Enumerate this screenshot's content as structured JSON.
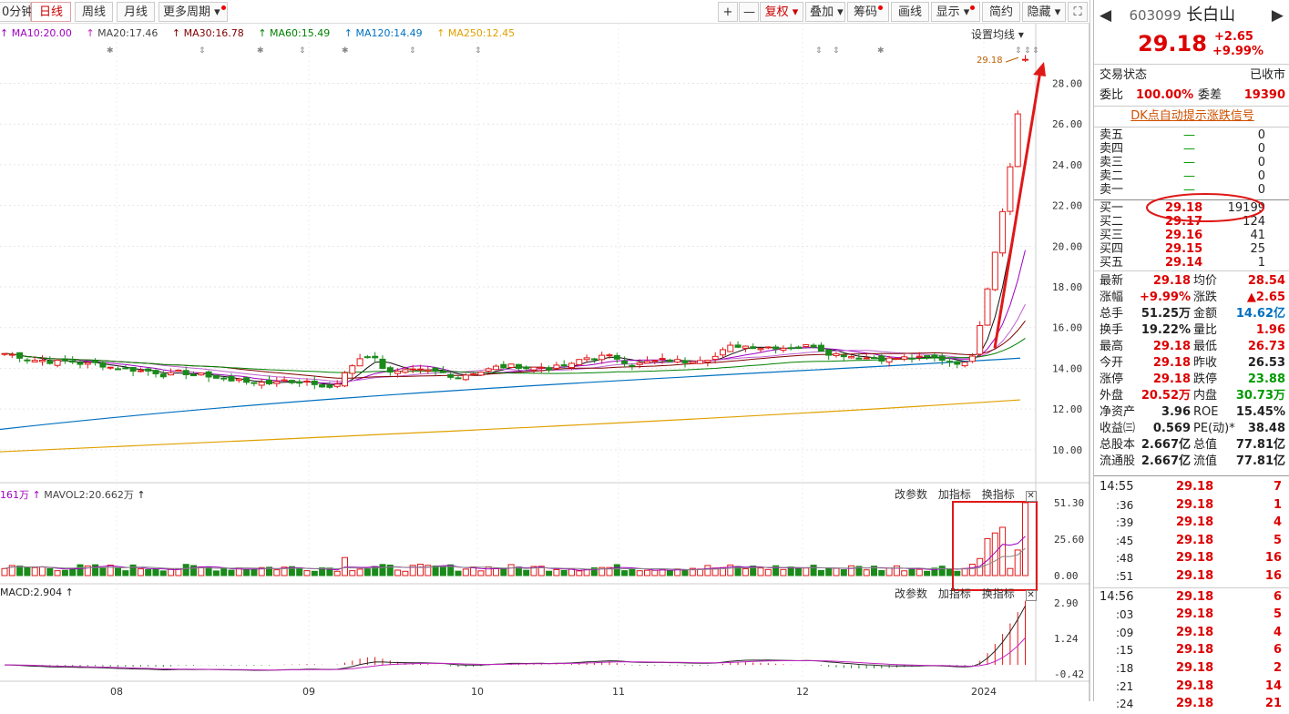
{
  "toolbar": {
    "tabs": [
      {
        "label": "0分钟",
        "active": false
      },
      {
        "label": "日线",
        "active": true
      },
      {
        "label": "周线",
        "active": false
      },
      {
        "label": "月线",
        "active": false
      },
      {
        "label": "更多周期",
        "active": false
      }
    ],
    "right_buttons": [
      "+",
      "—",
      "复权",
      "叠加",
      "筹码",
      "画线",
      "显示",
      "简约",
      "隐藏"
    ]
  },
  "ma_legend": [
    {
      "label": "MA10:20.00",
      "color": "#a000c0"
    },
    {
      "label": "MA20:17.46",
      "color": "#c020c0"
    },
    {
      "label": "MA30:16.78",
      "color": "#800000"
    },
    {
      "label": "MA60:15.49",
      "color": "#008000"
    },
    {
      "label": "MA120:14.49",
      "color": "#0070c0"
    },
    {
      "label": "MA250:12.45",
      "color": "#e0a000"
    }
  ],
  "set_ma_label": "设置均线",
  "price_axis": [
    "28.00",
    "26.00",
    "24.00",
    "22.00",
    "20.00",
    "18.00",
    "16.00",
    "14.00",
    "12.00",
    "10.00"
  ],
  "last_price_tag": "29.18",
  "volume_legend": {
    "vol": "161万",
    "mavol": "MAVOL2:20.662万"
  },
  "volume_axis": [
    "51.30",
    "25.60",
    "0.00"
  ],
  "macd_legend": "MACD:2.904",
  "macd_axis": [
    "2.90",
    "1.24",
    "-0.42"
  ],
  "panel_links": [
    "改参数",
    "加指标",
    "换指标"
  ],
  "x_labels": [
    "08",
    "09",
    "10",
    "11",
    "12",
    "2024"
  ],
  "chart_data": {
    "type": "candlestick",
    "recent_closes": [
      14.2,
      14.3,
      14.6,
      16.1,
      17.9,
      19.7,
      21.7,
      23.9,
      26.5,
      29.18
    ],
    "last_close": 29.18,
    "ylim": [
      9.5,
      29.5
    ]
  },
  "quote": {
    "code": "603099",
    "name": "长白山",
    "price": "29.18",
    "change": "+2.65",
    "change_pct": "+9.99%",
    "trade_status_label": "交易状态",
    "trade_status": "已收市",
    "ratio_label": "委比",
    "ratio": "100.00%",
    "diff_label": "委差",
    "diff": "19390",
    "dk_link": "DK点自动提示涨跌信号"
  },
  "sell_orders": [
    {
      "label": "卖五",
      "price": "—",
      "vol": "0"
    },
    {
      "label": "卖四",
      "price": "—",
      "vol": "0"
    },
    {
      "label": "卖三",
      "price": "—",
      "vol": "0"
    },
    {
      "label": "卖二",
      "price": "—",
      "vol": "0"
    },
    {
      "label": "卖一",
      "price": "—",
      "vol": "0"
    }
  ],
  "buy_orders": [
    {
      "label": "买一",
      "price": "29.18",
      "vol": "19199"
    },
    {
      "label": "买二",
      "price": "29.17",
      "vol": "124"
    },
    {
      "label": "买三",
      "price": "29.16",
      "vol": "41"
    },
    {
      "label": "买四",
      "price": "29.15",
      "vol": "25"
    },
    {
      "label": "买五",
      "price": "29.14",
      "vol": "1"
    }
  ],
  "stats": [
    {
      "l1": "最新",
      "v1": "29.18",
      "c1": "r",
      "l2": "均价",
      "v2": "28.54",
      "c2": "r"
    },
    {
      "l1": "涨幅",
      "v1": "+9.99%",
      "c1": "r",
      "l2": "涨跌",
      "v2": "▲2.65",
      "c2": "r"
    },
    {
      "l1": "总手",
      "v1": "51.25万",
      "c1": "",
      "l2": "金额",
      "v2": "14.62亿",
      "c2": "b"
    },
    {
      "l1": "换手",
      "v1": "19.22%",
      "c1": "",
      "l2": "量比",
      "v2": "1.96",
      "c2": "r"
    },
    {
      "l1": "最高",
      "v1": "29.18",
      "c1": "r",
      "l2": "最低",
      "v2": "26.73",
      "c2": "r"
    },
    {
      "l1": "今开",
      "v1": "29.18",
      "c1": "r",
      "l2": "昨收",
      "v2": "26.53",
      "c2": ""
    },
    {
      "l1": "涨停",
      "v1": "29.18",
      "c1": "r",
      "l2": "跌停",
      "v2": "23.88",
      "c2": "g"
    },
    {
      "l1": "外盘",
      "v1": "20.52万",
      "c1": "r",
      "l2": "内盘",
      "v2": "30.73万",
      "c2": "g"
    },
    {
      "l1": "净资产",
      "v1": "3.96",
      "c1": "",
      "l2": "ROE",
      "v2": "15.45%",
      "c2": ""
    },
    {
      "l1": "收益㈢",
      "v1": "0.569",
      "c1": "",
      "l2": "PE(动)*",
      "v2": "38.48",
      "c2": ""
    },
    {
      "l1": "总股本",
      "v1": "2.667亿",
      "c1": "",
      "l2": "总值",
      "v2": "77.81亿",
      "c2": ""
    },
    {
      "l1": "流通股",
      "v1": "2.667亿",
      "c1": "",
      "l2": "流值",
      "v2": "77.81亿",
      "c2": ""
    }
  ],
  "ticks": [
    {
      "t": "14:55",
      "p": "29.18",
      "v": "7"
    },
    {
      "t": ":36",
      "p": "29.18",
      "v": "1"
    },
    {
      "t": ":39",
      "p": "29.18",
      "v": "4"
    },
    {
      "t": ":45",
      "p": "29.18",
      "v": "5"
    },
    {
      "t": ":48",
      "p": "29.18",
      "v": "16"
    },
    {
      "t": ":51",
      "p": "29.18",
      "v": "16"
    },
    {
      "t": "14:56",
      "p": "29.18",
      "v": "6"
    },
    {
      "t": ":03",
      "p": "29.18",
      "v": "5"
    },
    {
      "t": ":09",
      "p": "29.18",
      "v": "4"
    },
    {
      "t": ":15",
      "p": "29.18",
      "v": "6"
    },
    {
      "t": ":18",
      "p": "29.18",
      "v": "2"
    },
    {
      "t": ":21",
      "p": "29.18",
      "v": "14"
    },
    {
      "t": ":24",
      "p": "29.18",
      "v": "21"
    }
  ]
}
